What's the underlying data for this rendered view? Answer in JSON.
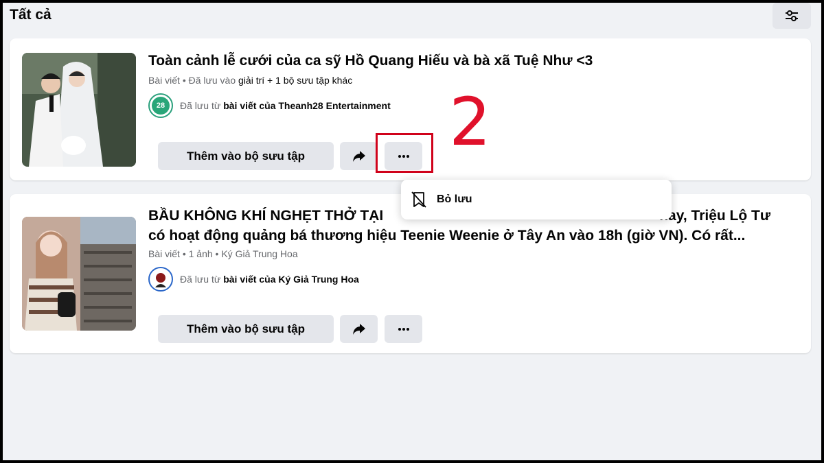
{
  "header": {
    "title": "Tất cả"
  },
  "items": [
    {
      "title_lines": [
        "Toàn cảnh lễ cưới của ca sỹ Hồ Quang Hiếu và bà xã Tuệ Như <3"
      ],
      "meta": {
        "type": "Bài viết",
        "sep": "•",
        "prefix": "Đã lưu vào",
        "collection": "giải trí",
        "suffix": "+ 1 bộ sưu tập khác"
      },
      "source": {
        "prefix": "Đã lưu từ",
        "link": "bài viết của Theanh28 Entertainment",
        "avatar_text": "28"
      },
      "buttons": {
        "add": "Thêm vào bộ sưu tập",
        "share_icon": "share-icon",
        "more_icon": "more-icon"
      }
    },
    {
      "title_lines": [
        "BẦU KHÔNG KHÍ NGHẸT THỞ TẠI",
        "nay, Triệu Lộ Tư",
        "có hoạt động quảng bá thương hiệu Teenie Weenie ở Tây An vào 18h (giờ VN). Có rất..."
      ],
      "meta": {
        "type": "Bài viết",
        "sep": "•",
        "detail": "1 ảnh",
        "author": "Ký Giả Trung Hoa"
      },
      "source": {
        "prefix": "Đã lưu từ",
        "link": "bài viết của Ký Giả Trung Hoa"
      },
      "buttons": {
        "add": "Thêm vào bộ sưu tập",
        "share_icon": "share-icon",
        "more_icon": "more-icon"
      }
    }
  ],
  "menu": {
    "unsave_label": "Bỏ lưu",
    "icon": "unsave-icon"
  },
  "annotation": {
    "step_number": "2",
    "color": "#e0112b"
  },
  "colors": {
    "background": "#f0f2f5",
    "button": "#e4e6eb",
    "text": "#050505",
    "secondary": "#65676b"
  }
}
